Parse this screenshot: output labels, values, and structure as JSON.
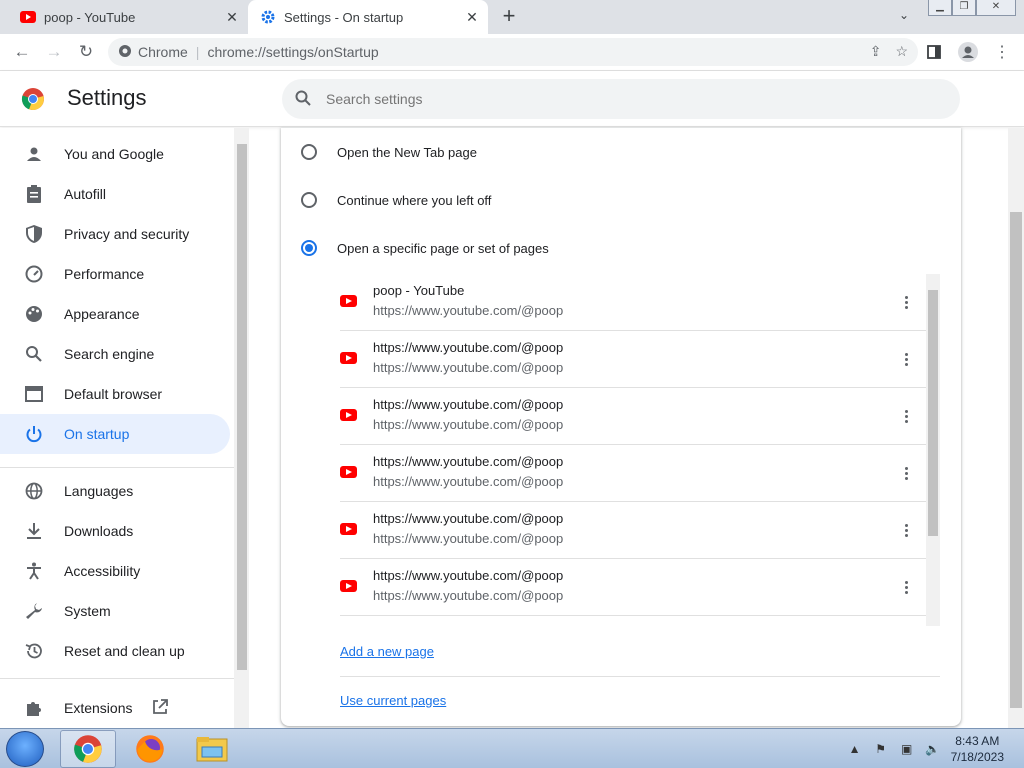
{
  "browser": {
    "tabs": [
      {
        "title": "poop - YouTube",
        "icon": "youtube-icon",
        "active": false
      },
      {
        "title": "Settings - On startup",
        "icon": "settings-gear-icon",
        "active": true
      }
    ],
    "omnibox": {
      "site_label": "Chrome",
      "url": "chrome://settings/onStartup"
    }
  },
  "settings": {
    "title": "Settings",
    "search_placeholder": "Search settings"
  },
  "sidebar": {
    "items": [
      {
        "label": "You and Google",
        "icon": "person-icon"
      },
      {
        "label": "Autofill",
        "icon": "clipboard-icon"
      },
      {
        "label": "Privacy and security",
        "icon": "shield-icon"
      },
      {
        "label": "Performance",
        "icon": "speedometer-icon"
      },
      {
        "label": "Appearance",
        "icon": "palette-icon"
      },
      {
        "label": "Search engine",
        "icon": "search-icon"
      },
      {
        "label": "Default browser",
        "icon": "browser-window-icon"
      },
      {
        "label": "On startup",
        "icon": "power-icon",
        "active": true
      },
      {
        "label": "Languages",
        "icon": "globe-icon"
      },
      {
        "label": "Downloads",
        "icon": "download-icon"
      },
      {
        "label": "Accessibility",
        "icon": "accessibility-icon"
      },
      {
        "label": "System",
        "icon": "wrench-icon"
      },
      {
        "label": "Reset and clean up",
        "icon": "history-icon"
      },
      {
        "label": "Extensions",
        "icon": "puzzle-icon"
      }
    ]
  },
  "startup": {
    "options": [
      {
        "label": "Open the New Tab page",
        "checked": false
      },
      {
        "label": "Continue where you left off",
        "checked": false
      },
      {
        "label": "Open a specific page or set of pages",
        "checked": true
      }
    ],
    "pages": [
      {
        "title": "poop - YouTube",
        "url": "https://www.youtube.com/@poop"
      },
      {
        "title": "https://www.youtube.com/@poop",
        "url": "https://www.youtube.com/@poop"
      },
      {
        "title": "https://www.youtube.com/@poop",
        "url": "https://www.youtube.com/@poop"
      },
      {
        "title": "https://www.youtube.com/@poop",
        "url": "https://www.youtube.com/@poop"
      },
      {
        "title": "https://www.youtube.com/@poop",
        "url": "https://www.youtube.com/@poop"
      },
      {
        "title": "https://www.youtube.com/@poop",
        "url": "https://www.youtube.com/@poop"
      }
    ],
    "add_page_label": "Add a new page",
    "use_current_label": "Use current pages"
  },
  "taskbar": {
    "time": "8:43 AM",
    "date": "7/18/2023"
  },
  "colors": {
    "accent": "#1a73e8",
    "active_bg": "#e8f0fe"
  }
}
